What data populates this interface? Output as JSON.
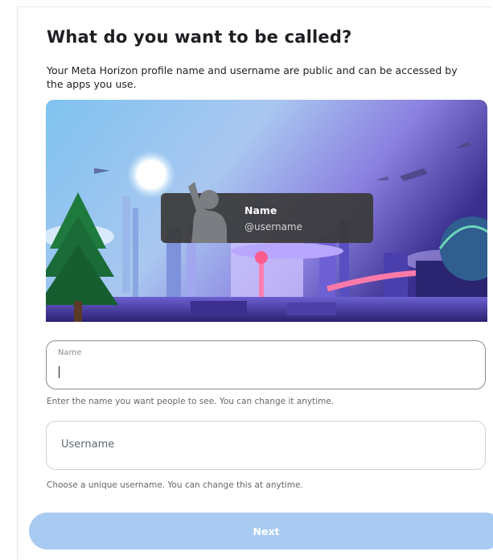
{
  "page": {
    "title": "What do you want to be called?",
    "subtitle": "Your Meta Horizon profile name and username are public and can be accessed by the apps you use."
  },
  "hero": {
    "illustration": "futuristic-city-scene",
    "preview": {
      "name": "Name",
      "username": "@username",
      "avatar_icon": "person-silhouette-icon"
    }
  },
  "form": {
    "name_field": {
      "label": "Name",
      "value": "",
      "helper": "Enter the name you want people to see. You can change it anytime."
    },
    "username_field": {
      "placeholder": "Username",
      "value": "",
      "helper": "Choose a unique username. You can change this at anytime."
    },
    "next_label": "Next"
  },
  "colors": {
    "button_disabled": "#a9cbf2",
    "text_primary": "#1c1e21",
    "text_secondary": "#65676b"
  }
}
